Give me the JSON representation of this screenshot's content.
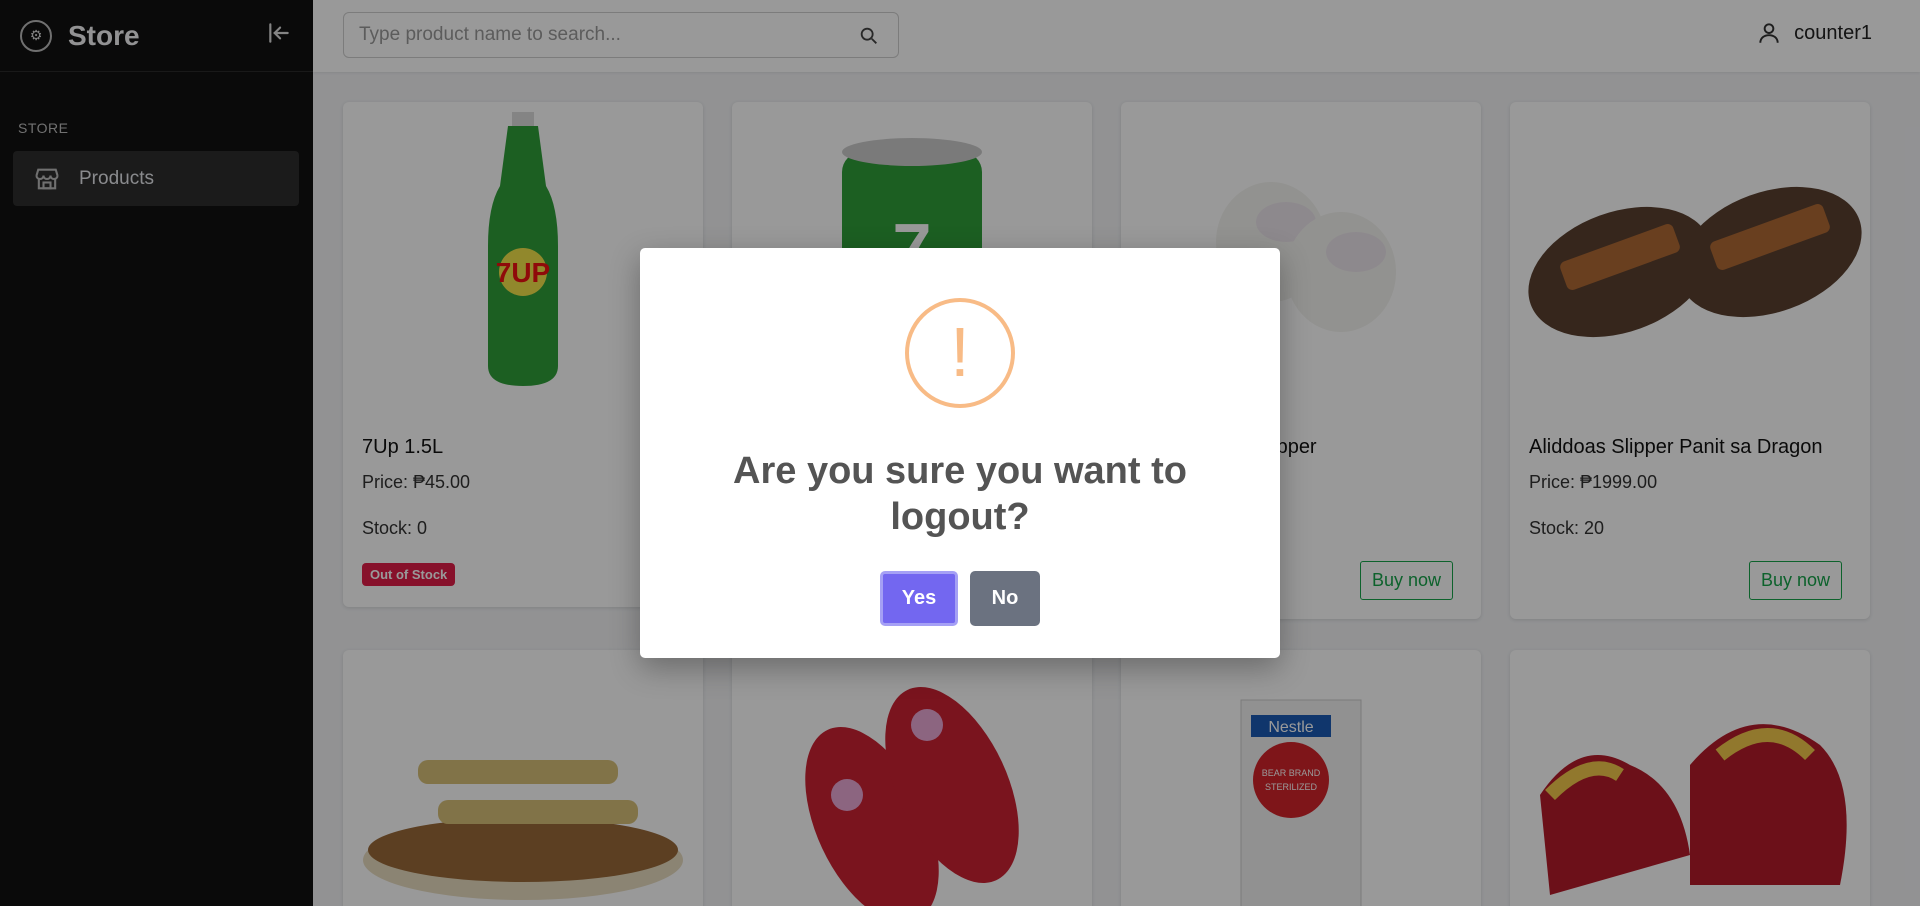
{
  "sidebar": {
    "title": "Store",
    "section_label": "STORE",
    "items": [
      {
        "label": "Products",
        "icon": "storefront-icon"
      }
    ]
  },
  "header": {
    "search_placeholder": "Type product name to search...",
    "username": "counter1"
  },
  "products": [
    {
      "name": "7Up 1.5L",
      "price": "Price: ₱45.00",
      "stock": "Stock: 0",
      "status": "Out of Stock"
    },
    {
      "name": "",
      "price": "",
      "stock": "",
      "status": ""
    },
    {
      "name": "n slipper",
      "price": "",
      "stock": "",
      "action": "Buy now"
    },
    {
      "name": "Aliddoas Slipper Panit sa Dragon",
      "price": "Price: ₱1999.00",
      "stock": "Stock: 20",
      "action": "Buy now"
    }
  ],
  "image_labels": {
    "seven_up_bottle": "7UP",
    "seven_up_can": "7",
    "milk_brand": "Nestle",
    "milk_line1": "BEAR BRAND",
    "milk_line2": "STERILIZED"
  },
  "modal": {
    "icon": "!",
    "title": "Are you sure you want to logout?",
    "confirm_label": "Yes",
    "cancel_label": "No"
  },
  "colors": {
    "accent": "#7367f0",
    "danger": "#e11d48",
    "success": "#16a34a",
    "warning": "#f8bb86"
  }
}
